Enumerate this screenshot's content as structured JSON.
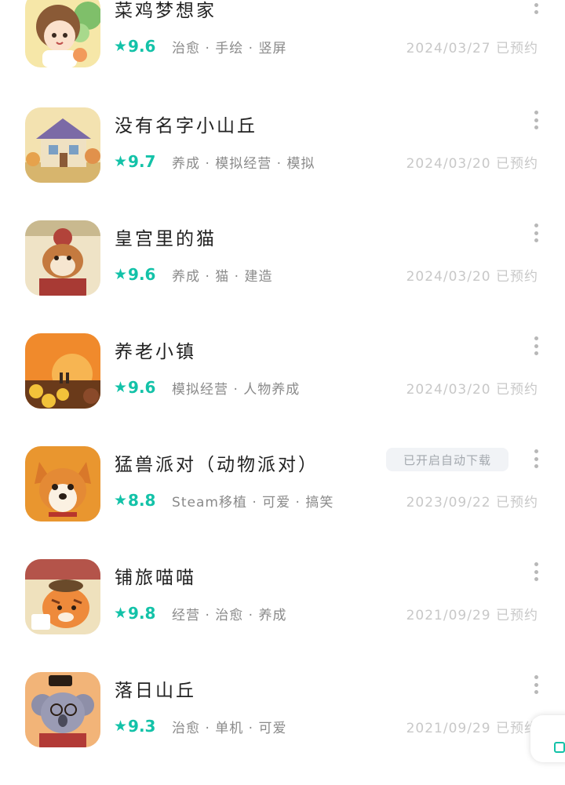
{
  "accent_color": "#13c2a8",
  "games": [
    {
      "title": "菜鸡梦想家",
      "score": "9.6",
      "tags": "治愈 · 手绘 · 竖屏",
      "date": "2024/03/27 已预约",
      "icon": "chibi-girl-icon"
    },
    {
      "title": "没有名字小山丘",
      "score": "9.7",
      "tags": "养成 · 模拟经营 · 模拟",
      "date": "2024/03/20 已预约",
      "icon": "cottage-icon"
    },
    {
      "title": "皇宫里的猫",
      "score": "9.6",
      "tags": "养成 · 猫 · 建造",
      "date": "2024/03/20 已预约",
      "icon": "palace-cat-icon"
    },
    {
      "title": "养老小镇",
      "score": "9.6",
      "tags": "模拟经营 · 人物养成",
      "date": "2024/03/20 已预约",
      "icon": "sunset-field-icon"
    },
    {
      "title": "猛兽派对（动物派对）",
      "score": "8.8",
      "tags": "Steam移植 · 可爱 · 搞笑",
      "date": "2023/09/22 已预约",
      "icon": "corgi-icon",
      "badge": "已开启自动下载"
    },
    {
      "title": "铺旅喵喵",
      "score": "9.8",
      "tags": "经营 · 治愈 · 养成",
      "date": "2021/09/29 已预约",
      "icon": "tiger-cat-icon"
    },
    {
      "title": "落日山丘",
      "score": "9.3",
      "tags": "治愈 · 单机 · 可爱",
      "date": "2021/09/29 已预约",
      "icon": "koala-icon"
    }
  ]
}
